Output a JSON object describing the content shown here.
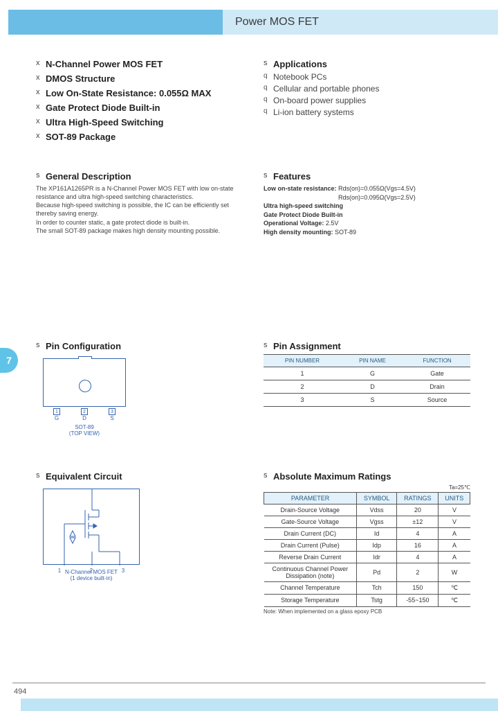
{
  "header": {
    "title": "Power MOS FET"
  },
  "badge": "7",
  "page_number": "494",
  "bullets": [
    "N-Channel Power MOS FET",
    "DMOS Structure",
    "Low On-State Resistance: 0.055Ω MAX",
    "Gate Protect Diode Built-in",
    "Ultra High-Speed Switching",
    "SOT-89 Package"
  ],
  "applications": {
    "heading": "Applications",
    "items": [
      "Notebook PCs",
      "Cellular and portable phones",
      "On-board power supplies",
      "Li-ion battery systems"
    ]
  },
  "general_description": {
    "heading": "General Description",
    "p1": "The XP161A1265PR is a N-Channel Power MOS FET with low on-state resistance and ultra high-speed switching characteristics.",
    "p2": "Because high-speed switching is possible, the IC can be efficiently set thereby saving energy.",
    "p3": "In order to counter static, a gate protect diode is built-in.",
    "p4": "The small SOT-89 package makes high density mounting possible."
  },
  "features": {
    "heading": "Features",
    "l1a": "Low on-state resistance:",
    "l1b": "Rds(on)=0.055Ω(Vgs=4.5V)",
    "l1c": "Rds(on)=0.095Ω(Vgs=2.5V)",
    "l2": "Ultra high-speed switching",
    "l3": "Gate Protect Diode Built-in",
    "l4a": "Operational Voltage:",
    "l4b": "2.5V",
    "l5a": "High density mounting:",
    "l5b": "SOT-89"
  },
  "pin_config": {
    "heading": "Pin Configuration",
    "caption1": "SOT-89",
    "caption2": "(TOP VIEW)",
    "labels": {
      "p1": "1",
      "p2": "2",
      "p3": "3",
      "n1": "G",
      "n2": "D",
      "n3": "S"
    }
  },
  "pin_assign": {
    "heading": "Pin Assignment",
    "headers": {
      "num": "PIN NUMBER",
      "name": "PIN NAME",
      "func": "FUNCTION"
    },
    "rows": [
      {
        "num": "1",
        "name": "G",
        "func": "Gate"
      },
      {
        "num": "2",
        "name": "D",
        "func": "Drain"
      },
      {
        "num": "3",
        "name": "S",
        "func": "Source"
      }
    ]
  },
  "eq_circuit": {
    "heading": "Equivalent Circuit",
    "caption1": "N-Channel MOS FET",
    "caption2": "(1 device built-in)",
    "p1": "1",
    "p2": "2",
    "p3": "3"
  },
  "max_ratings": {
    "heading": "Absolute Maximum Ratings",
    "ta": "Ta=25℃",
    "headers": {
      "param": "PARAMETER",
      "sym": "SYMBOL",
      "rat": "RATINGS",
      "units": "UNITS"
    },
    "rows": [
      {
        "param": "Drain-Source Voltage",
        "sym": "Vdss",
        "rat": "20",
        "units": "V"
      },
      {
        "param": "Gate-Source Voltage",
        "sym": "Vgss",
        "rat": "±12",
        "units": "V"
      },
      {
        "param": "Drain Current (DC)",
        "sym": "Id",
        "rat": "4",
        "units": "A"
      },
      {
        "param": "Drain Current (Pulse)",
        "sym": "Idp",
        "rat": "16",
        "units": "A"
      },
      {
        "param": "Reverse Drain Current",
        "sym": "Idr",
        "rat": "4",
        "units": "A"
      },
      {
        "param": "Continuous Channel Power Dissipation (note)",
        "sym": "Pd",
        "rat": "2",
        "units": "W"
      },
      {
        "param": "Channel Temperature",
        "sym": "Tch",
        "rat": "150",
        "units": "℃"
      },
      {
        "param": "Storage Temperature",
        "sym": "Tstg",
        "rat": "-55~150",
        "units": "℃"
      }
    ],
    "note": "Note: When implemented on a glass epoxy PCB"
  }
}
